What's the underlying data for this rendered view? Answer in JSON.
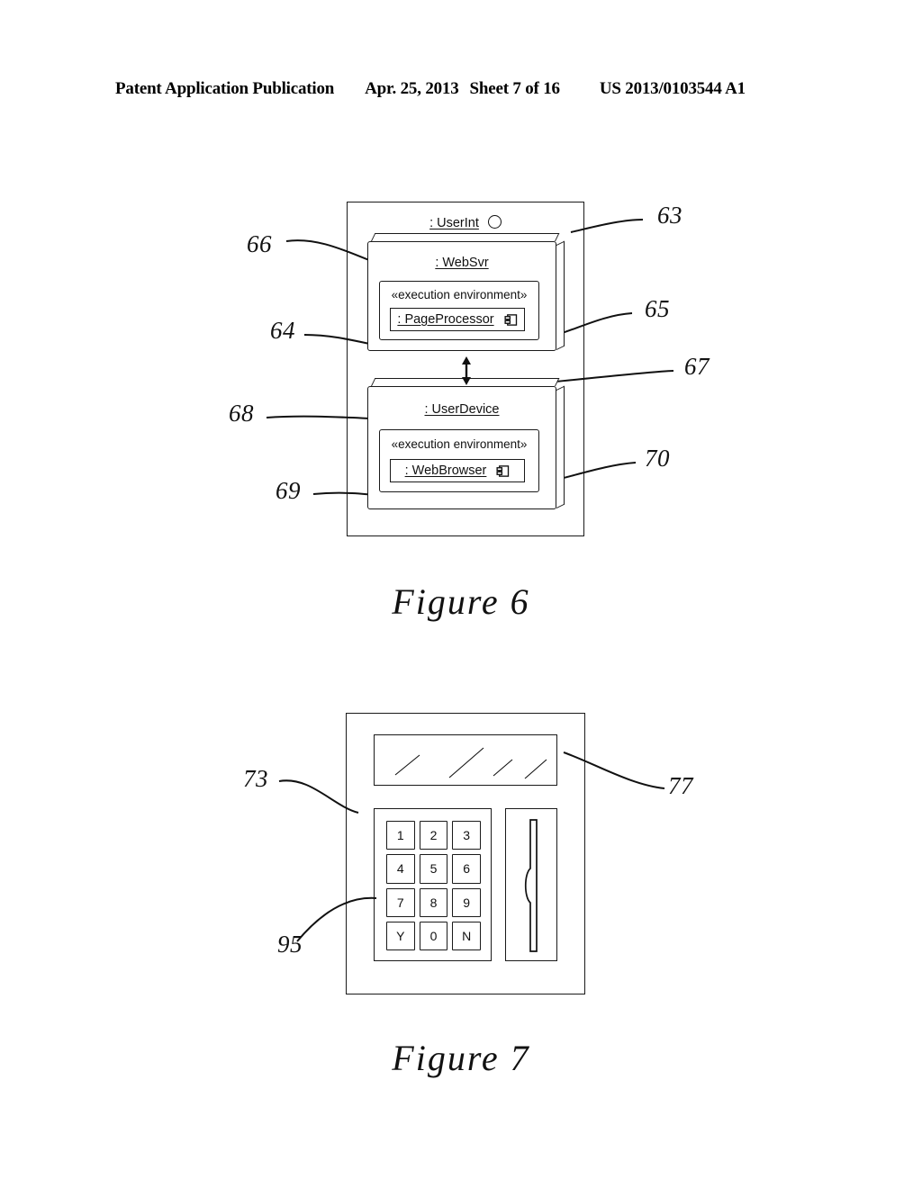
{
  "header": {
    "publication": "Patent Application Publication",
    "date": "Apr. 25, 2013",
    "sheet": "Sheet 7 of 16",
    "patent_number": "US 2013/0103544 A1"
  },
  "figure6": {
    "caption": "Figure 6",
    "outer_node": {
      "label": ": UserInt",
      "interface_icon": "provided-interface-circle-icon",
      "ref": "63"
    },
    "web_server_node": {
      "label": ": WebSvr",
      "ref": "66",
      "exec_env": {
        "stereotype": "«execution environment»",
        "ref": "65",
        "artifact": {
          "label": ": PageProcessor",
          "icon": "uml-component-icon",
          "ref": "64"
        }
      }
    },
    "user_device_node": {
      "label": ": UserDevice",
      "ref": "68",
      "exec_env": {
        "stereotype": "«execution environment»",
        "ref": "70",
        "artifact": {
          "label": ": WebBrowser",
          "icon": "uml-component-icon",
          "ref": "69"
        }
      }
    },
    "communication_path": {
      "icon": "double-headed-arrow-icon",
      "ref": "67"
    }
  },
  "figure7": {
    "caption": "Figure 7",
    "terminal": {
      "ref": "73",
      "display": {
        "name": "display-screen",
        "ref": "77",
        "reflection_lines": 4
      },
      "keypad": {
        "ref": "95",
        "keys": [
          "1",
          "2",
          "3",
          "4",
          "5",
          "6",
          "7",
          "8",
          "9",
          "Y",
          "0",
          "N"
        ]
      },
      "card_slot": {
        "name": "card-slot",
        "icon": "card-slot-notch-icon"
      }
    }
  },
  "colors": {
    "ink": "#1a1a1a",
    "paper": "#ffffff"
  }
}
